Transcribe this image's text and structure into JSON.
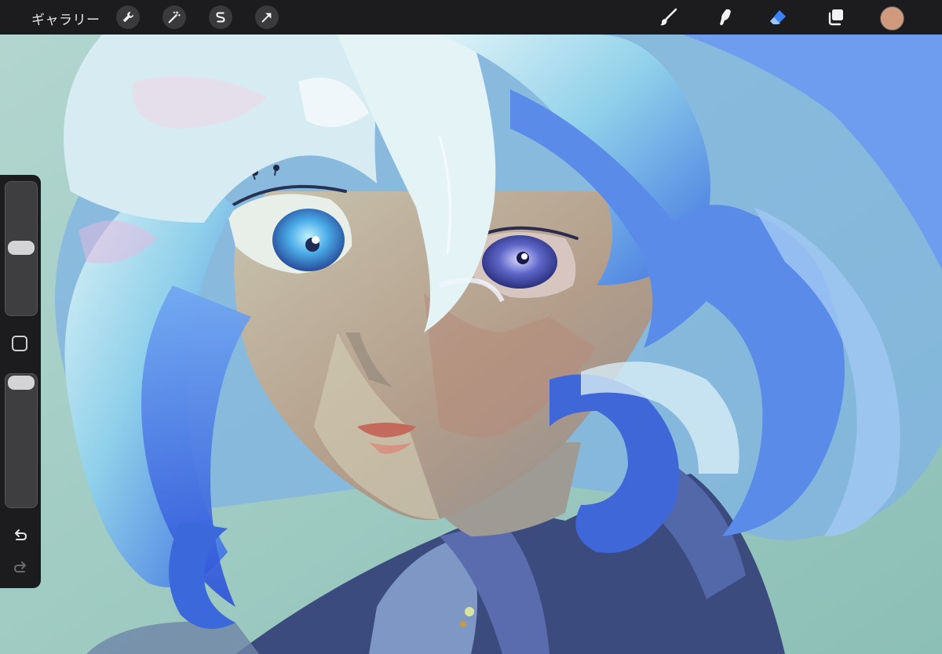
{
  "toolbar": {
    "gallery_label": "ギャラリー",
    "left_tools": [
      "wrench-icon",
      "magic-wand-icon",
      "selection-icon",
      "transform-arrow-icon"
    ],
    "right_tools": [
      "brush-icon",
      "smudge-icon",
      "eraser-icon",
      "layers-icon"
    ],
    "active_tool": "eraser-icon",
    "current_color": "#cf9a7e",
    "accent_color": "#3b82f6"
  },
  "sidebar": {
    "brush_size_level": 0.45,
    "opacity_level": 0.05,
    "modify_button": "square-icon",
    "undo": "undo-icon",
    "redo": "redo-icon"
  }
}
